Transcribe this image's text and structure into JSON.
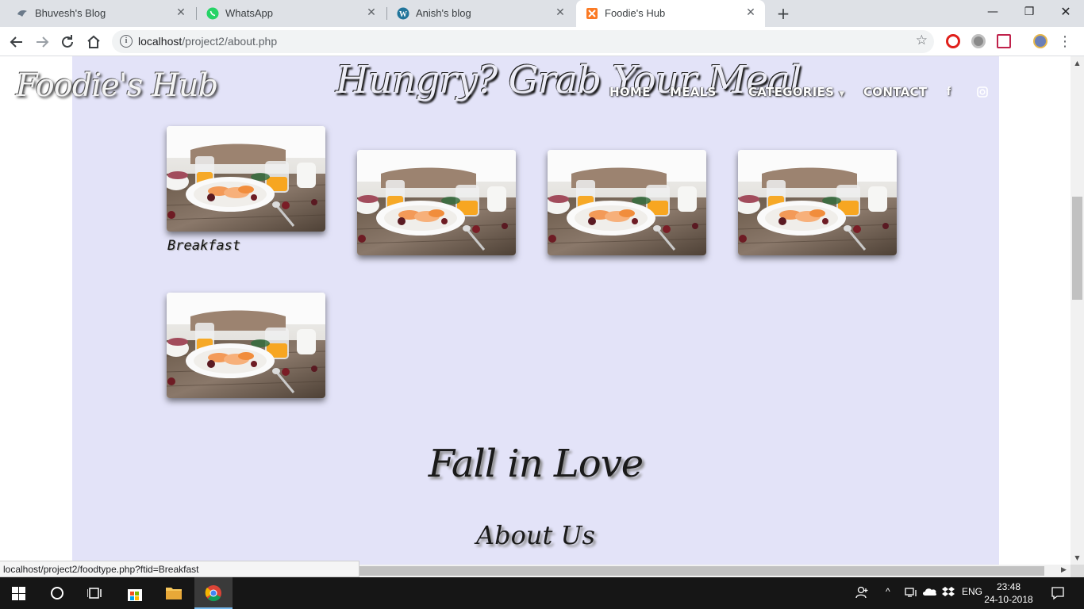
{
  "browser": {
    "tabs": [
      {
        "title": "Bhuvesh's Blog",
        "icon": "bird-icon"
      },
      {
        "title": "WhatsApp",
        "icon": "whatsapp-icon"
      },
      {
        "title": "Anish's blog",
        "icon": "wordpress-icon"
      },
      {
        "title": "Foodie's Hub",
        "icon": "xampp-icon",
        "active": true
      }
    ],
    "url_host": "localhost",
    "url_path": "/project2/about.php",
    "status_url": "localhost/project2/foodtype.php?ftid=Breakfast"
  },
  "site": {
    "brand": "Foodie's Hub",
    "tagline": "Hungry? Grab Your Meal",
    "nav": {
      "home": "HOME",
      "meals": "MEALS",
      "categories": "CATEGORIES",
      "contact": "CONTACT"
    },
    "food_caption": "Breakfast",
    "fall_heading": "Fall in Love",
    "about_heading": "About Us"
  },
  "taskbar": {
    "language": "ENG",
    "time": "23:48",
    "date": "24-10-2018"
  },
  "colors": {
    "page_bg": "#e3e3f8",
    "tab_strip": "#dee1e6",
    "taskbar": "#161616"
  }
}
